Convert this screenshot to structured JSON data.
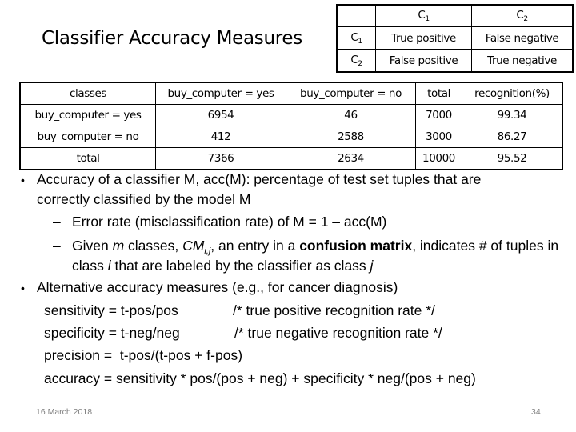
{
  "slide": {
    "title": "Classifier Accuracy Measures",
    "footer_date": "16 March 2018",
    "page_number": "34"
  },
  "confusion_template": {
    "col_headers": [
      {
        "base": "C",
        "sub": "1"
      },
      {
        "base": "C",
        "sub": "2"
      }
    ],
    "rows": [
      {
        "label": {
          "base": "C",
          "sub": "1"
        },
        "cells": [
          "True positive",
          "False negative"
        ]
      },
      {
        "label": {
          "base": "C",
          "sub": "2"
        },
        "cells": [
          "False positive",
          "True negative"
        ]
      }
    ]
  },
  "results_table": {
    "headers": [
      "classes",
      "buy_computer = yes",
      "buy_computer = no",
      "total",
      "recognition(%)"
    ],
    "rows": [
      [
        "buy_computer = yes",
        "6954",
        "46",
        "7000",
        "99.34"
      ],
      [
        "buy_computer = no",
        "412",
        "2588",
        "3000",
        "86.27"
      ],
      [
        "total",
        "7366",
        "2634",
        "10000",
        "95.52"
      ]
    ]
  },
  "bullets": {
    "b1_line1": "Accuracy of a classifier M, acc(M): percentage of test set tuples that are",
    "b1_line2": "correctly classified by the model M",
    "b1_sub1": "Error rate (misclassification rate) of M = 1 – acc(M)",
    "b1_sub2_a": "Given ",
    "b1_sub2_m": "m",
    "b1_sub2_b": " classes, ",
    "b1_sub2_cm": "CM",
    "b1_sub2_ij": "i,j",
    "b1_sub2_c": ", an entry in a ",
    "b1_sub2_bold": "confusion matrix",
    "b1_sub2_d": ", indicates # of tuples in",
    "b1_sub2_line2_a": "class ",
    "b1_sub2_line2_i": "i",
    "b1_sub2_line2_b": "  that are labeled by the classifier as class ",
    "b1_sub2_line2_j": "j",
    "b2_line1": "Alternative accuracy measures (e.g., for cancer diagnosis)",
    "formulas": [
      {
        "expr": "sensitivity = t-pos/pos",
        "comment": "/* true positive recognition rate */"
      },
      {
        "expr": "specificity = t-neg/neg",
        "comment": "/* true negative recognition rate */"
      },
      {
        "expr": "precision =  t-pos/(t-pos + f-pos)",
        "comment": ""
      },
      {
        "expr": "accuracy = sensitivity * pos/(pos + neg) + specificity * neg/(pos + neg)",
        "comment": ""
      }
    ],
    "bullet_char": "•",
    "dash_char": "–"
  }
}
